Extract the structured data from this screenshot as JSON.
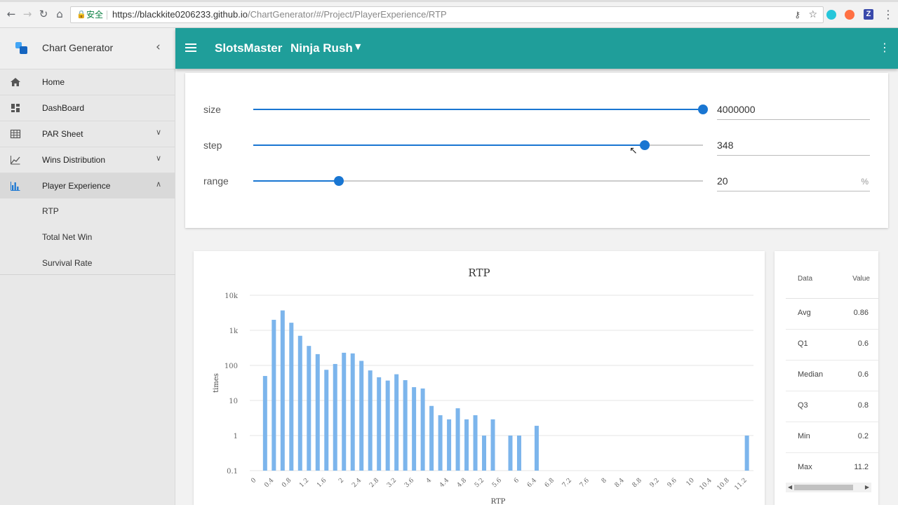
{
  "browser": {
    "secure_label": "安全",
    "url_host": "https://blackkite0206233.github.io",
    "url_path": "/ChartGenerator/#/Project/PlayerExperience/RTP"
  },
  "sidebar": {
    "title": "Chart Generator",
    "items": [
      {
        "label": "Home",
        "icon": "home-icon"
      },
      {
        "label": "DashBoard",
        "icon": "dashboard-icon"
      },
      {
        "label": "PAR Sheet",
        "icon": "table-icon"
      },
      {
        "label": "Wins Distribution",
        "icon": "line-chart-icon"
      },
      {
        "label": "Player Experience",
        "icon": "bar-chart-icon"
      }
    ],
    "subitems": [
      {
        "label": "RTP"
      },
      {
        "label": "Total Net Win"
      },
      {
        "label": "Survival Rate"
      }
    ],
    "accent": "#1976d2"
  },
  "header": {
    "app_name": "SlotsMaster",
    "game_name": "Ninja Rush",
    "color": "#1f9e9a"
  },
  "sliders": [
    {
      "name": "size",
      "value": "4000000",
      "fraction": 1.0,
      "unit": ""
    },
    {
      "name": "step",
      "value": "348",
      "fraction": 0.87,
      "unit": ""
    },
    {
      "name": "range",
      "value": "20",
      "fraction": 0.19,
      "unit": "%"
    }
  ],
  "stats": {
    "header_data": "Data",
    "header_value": "Value",
    "rows": [
      {
        "k": "Avg",
        "v": "0.86"
      },
      {
        "k": "Q1",
        "v": "0.6"
      },
      {
        "k": "Median",
        "v": "0.6"
      },
      {
        "k": "Q3",
        "v": "0.8"
      },
      {
        "k": "Min",
        "v": "0.2"
      },
      {
        "k": "Max",
        "v": "11.2"
      }
    ]
  },
  "chart_data": {
    "type": "bar",
    "title": "RTP",
    "xlabel": "RTP",
    "ylabel": "times",
    "y_scale": "log",
    "ylim": [
      0.1,
      10000
    ],
    "y_ticks": [
      "0.1",
      "1",
      "10",
      "100",
      "1k",
      "10k"
    ],
    "x_ticks": [
      "0",
      "0.4",
      "0.8",
      "1.2",
      "1.6",
      "2",
      "2.4",
      "2.8",
      "3.2",
      "3.6",
      "4",
      "4.4",
      "4.8",
      "5.2",
      "5.6",
      "6",
      "6.4",
      "6.8",
      "7.2",
      "7.6",
      "8",
      "8.4",
      "8.8",
      "9.2",
      "9.6",
      "10",
      "10.4",
      "10.8",
      "11.2"
    ],
    "bar_color": "#7cb5ec",
    "grid": true,
    "bars": [
      {
        "x": 0.2,
        "y": 50
      },
      {
        "x": 0.4,
        "y": 2000
      },
      {
        "x": 0.6,
        "y": 3700
      },
      {
        "x": 0.8,
        "y": 1650
      },
      {
        "x": 1.0,
        "y": 700
      },
      {
        "x": 1.2,
        "y": 360
      },
      {
        "x": 1.4,
        "y": 210
      },
      {
        "x": 1.6,
        "y": 75
      },
      {
        "x": 1.8,
        "y": 110
      },
      {
        "x": 2.0,
        "y": 230
      },
      {
        "x": 2.2,
        "y": 220
      },
      {
        "x": 2.4,
        "y": 135
      },
      {
        "x": 2.6,
        "y": 72
      },
      {
        "x": 2.8,
        "y": 46
      },
      {
        "x": 3.0,
        "y": 37
      },
      {
        "x": 3.2,
        "y": 56
      },
      {
        "x": 3.4,
        "y": 38
      },
      {
        "x": 3.6,
        "y": 24
      },
      {
        "x": 3.8,
        "y": 22
      },
      {
        "x": 4.0,
        "y": 7
      },
      {
        "x": 4.2,
        "y": 3.8
      },
      {
        "x": 4.4,
        "y": 2.9
      },
      {
        "x": 4.6,
        "y": 6
      },
      {
        "x": 4.8,
        "y": 2.9
      },
      {
        "x": 5.0,
        "y": 3.8
      },
      {
        "x": 5.2,
        "y": 1
      },
      {
        "x": 5.4,
        "y": 2.9
      },
      {
        "x": 5.8,
        "y": 1
      },
      {
        "x": 6.0,
        "y": 1
      },
      {
        "x": 6.4,
        "y": 1.9
      },
      {
        "x": 11.2,
        "y": 1
      }
    ]
  }
}
